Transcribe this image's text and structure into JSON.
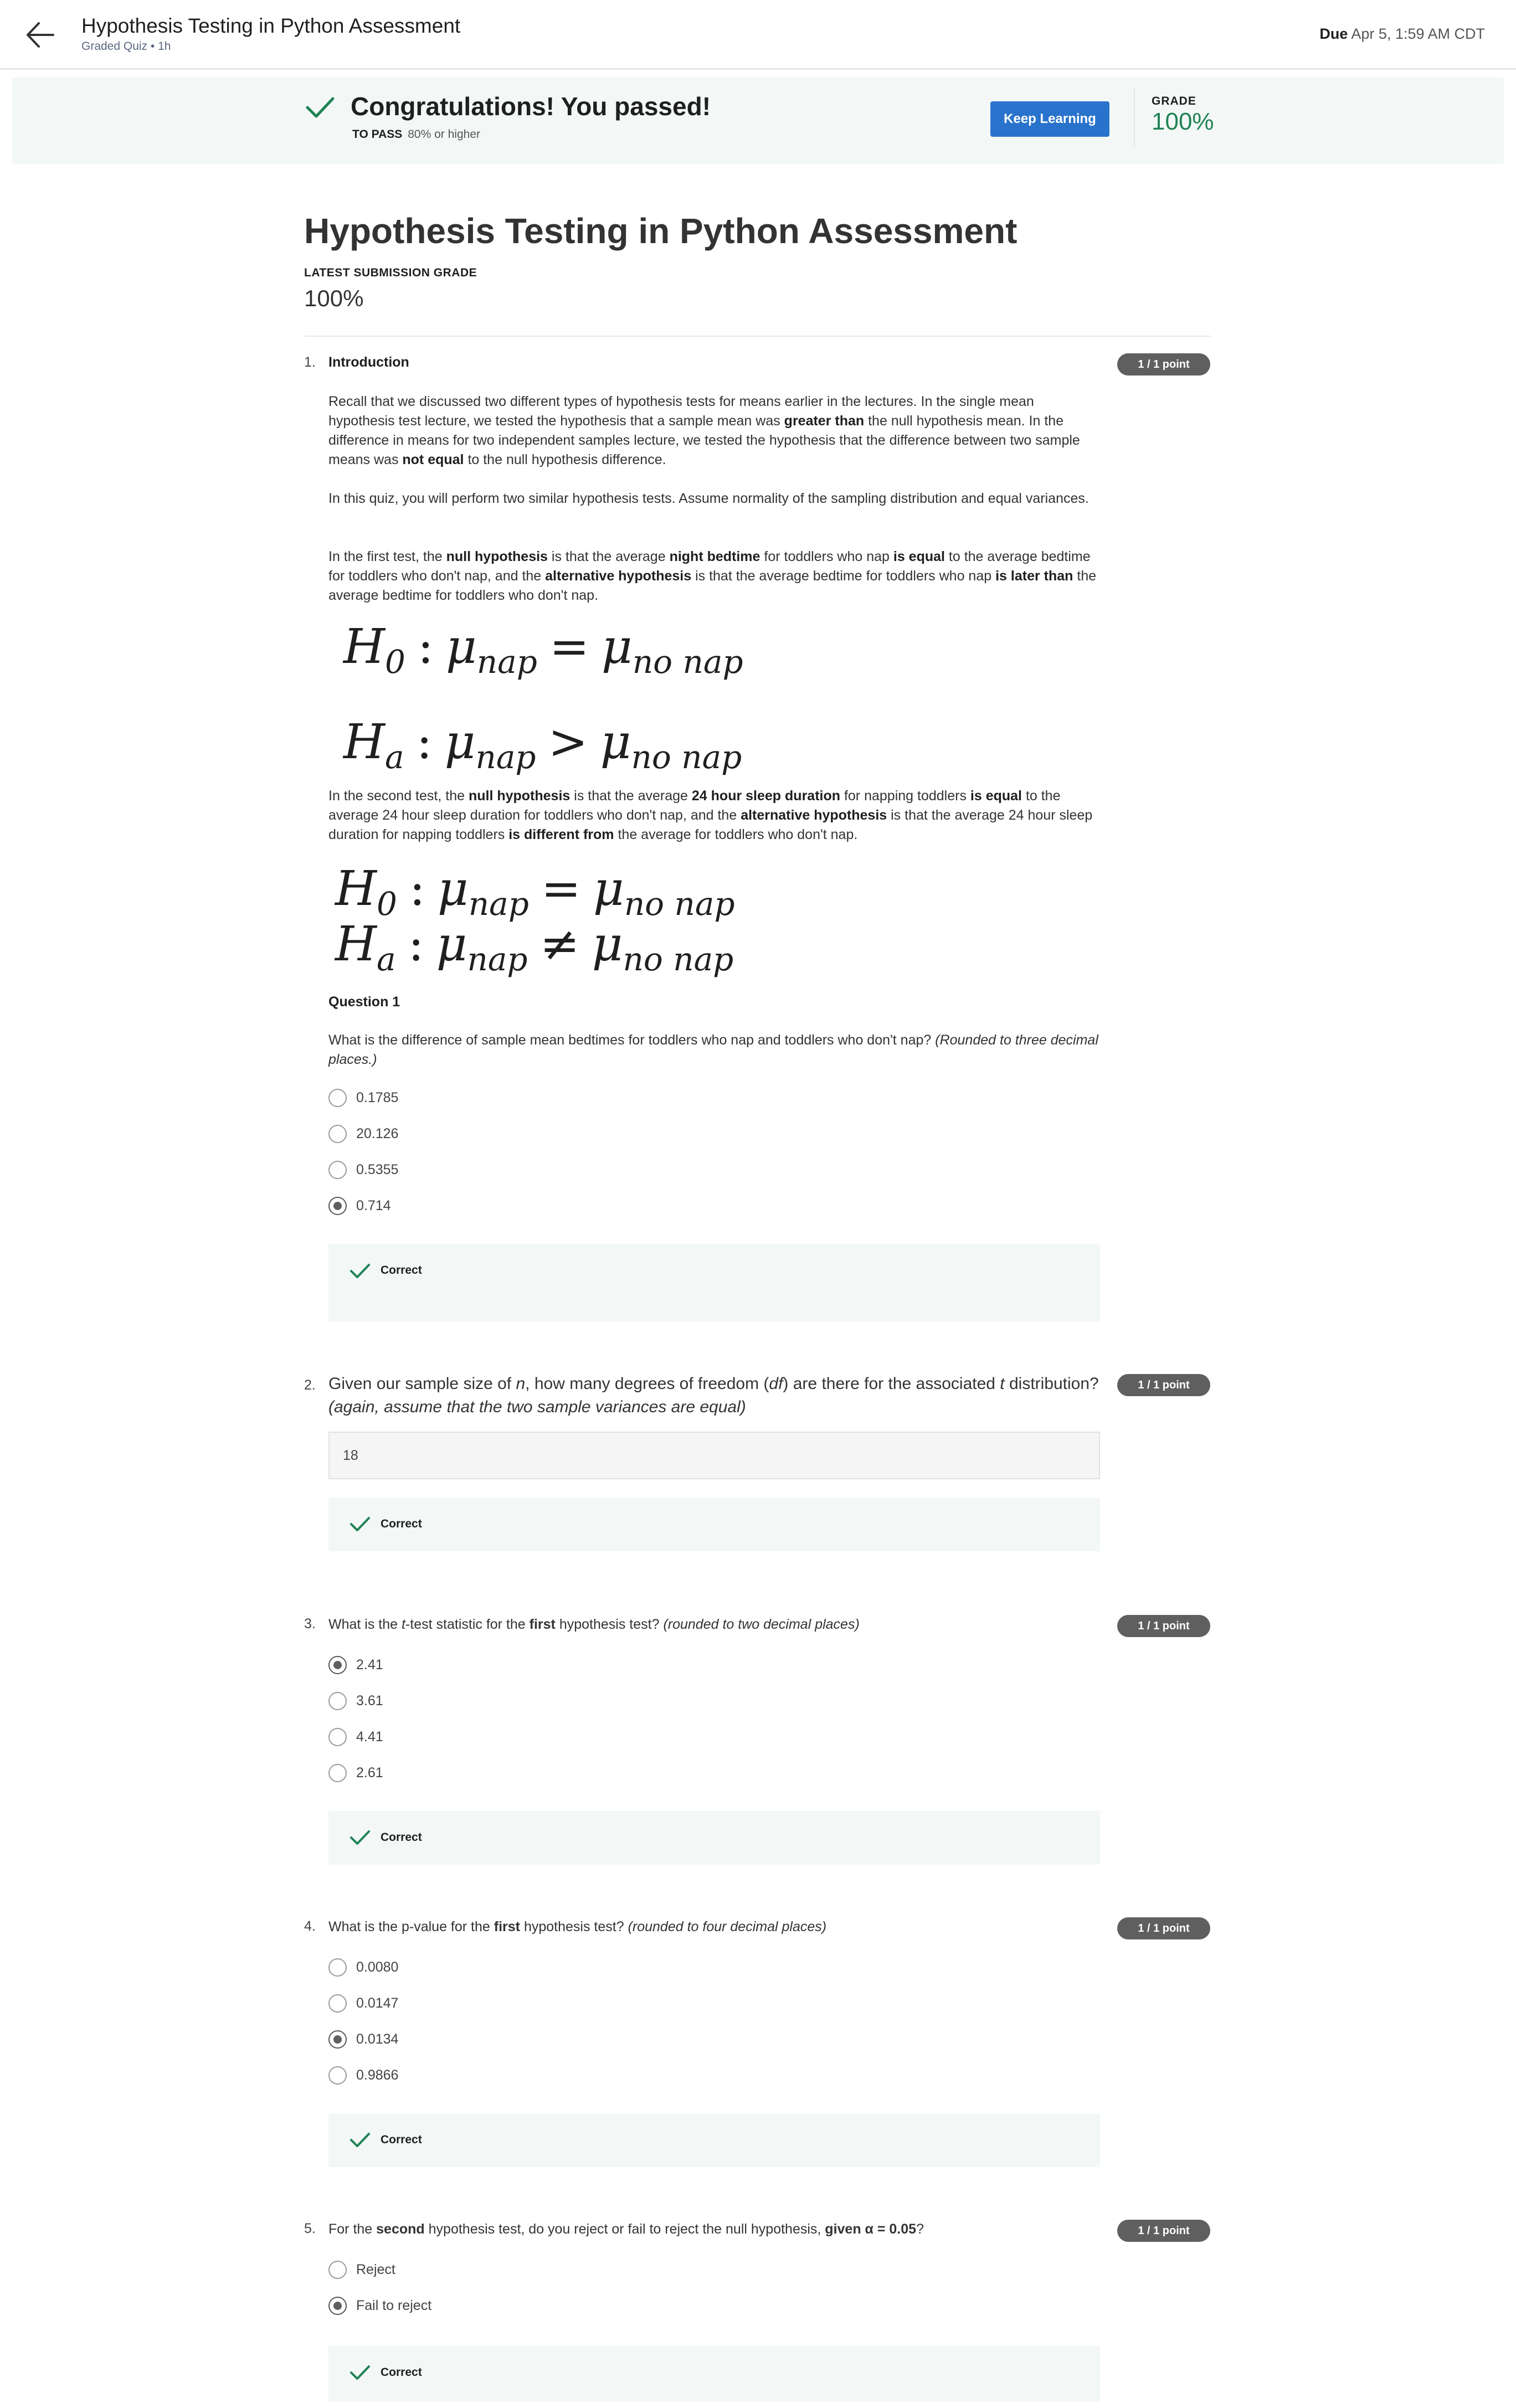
{
  "header": {
    "title": "Hypothesis Testing in Python Assessment",
    "subtitle": "Graded Quiz • 1h",
    "due_label": "Due",
    "due_value": "Apr 5, 1:59 AM CDT"
  },
  "banner": {
    "message": "Congratulations! You passed!",
    "to_pass_label": "TO PASS",
    "to_pass_value": "80% or higher",
    "keep_learning": "Keep Learning",
    "grade_label": "GRADE",
    "grade_value": "100%"
  },
  "page": {
    "title": "Hypothesis Testing in Python Assessment",
    "latest_label": "LATEST SUBMISSION GRADE",
    "latest_value": "100%"
  },
  "q1": {
    "number": "1.",
    "title": "Introduction",
    "points": "1 / 1 point",
    "para1": "Recall that we discussed two different types of hypothesis tests for means earlier in the lectures. In the single mean hypothesis test lecture, we tested the hypothesis that a sample mean was <b>greater than</b> the null hypothesis mean. In the difference in means for two independent samples lecture, we tested the hypothesis that the difference between two sample means was <b>not equal</b> to the null hypothesis difference.",
    "para2": "In this quiz, you will perform two similar hypothesis tests. Assume normality of the sampling distribution and equal variances.",
    "para3": "In the first test, the <b>null hypothesis</b> is that the average <b>night bedtime</b> for toddlers who nap <b>is equal</b> to the average bedtime for toddlers who don't nap, and the <b>alternative hypothesis</b> is that the average bedtime for toddlers who nap <b>is later than</b> the average bedtime for toddlers who don't nap.",
    "para4": "In the second test, the <b>null hypothesis</b> is that the average <b>24 hour sleep duration</b> for napping toddlers <b>is equal</b> to the average 24 hour sleep duration for toddlers who don't nap, and the <b>alternative hypothesis</b> is that the average 24 hour sleep duration for napping toddlers <b>is different from</b> the average for toddlers who don't nap.",
    "question_label": "Question 1",
    "question": "What is the difference of sample mean bedtimes for toddlers who nap and toddlers who don't nap? <i>(Rounded to three decimal places.)</i>",
    "options": [
      "0.1785",
      "20.126",
      "0.5355",
      "0.714"
    ],
    "feedback": "Correct"
  },
  "math": {
    "h0": "H",
    "h0_sub": "0",
    "ha": "H",
    "ha_sub": "a",
    "colon": ":",
    "mu": "μ",
    "nap": "nap",
    "no_nap": "no nap",
    "eq": "=",
    "gt": ">",
    "neq": "≠"
  },
  "q2": {
    "number": "2.",
    "points": "1 / 1 point",
    "question": "Given our sample size of <i>n</i>, how many degrees of freedom (<i>df</i>) are there for the associated <i>t</i> distribution? <i>(again, assume that the two sample variances are equal)</i>",
    "answer": "18",
    "feedback": "Correct"
  },
  "q3": {
    "number": "3.",
    "points": "1 / 1 point",
    "question": "What is the <i>t</i>-test statistic for the <b>first</b> hypothesis test? <i>(rounded to two decimal places)</i>",
    "options": [
      "2.41",
      "3.61",
      "4.41",
      "2.61"
    ],
    "feedback": "Correct"
  },
  "q4": {
    "number": "4.",
    "points": "1 / 1 point",
    "question": "What is the p-value for the <b>first</b> hypothesis test? <i>(rounded to four decimal places)</i>",
    "options": [
      "0.0080",
      "0.0147",
      "0.0134",
      "0.9866"
    ],
    "feedback": "Correct"
  },
  "q5": {
    "number": "5.",
    "points": "1 / 1 point",
    "question": "For the <b>second</b> hypothesis test, do you reject or fail to reject the null hypothesis, <b>given α = 0.05</b>?",
    "options": [
      "Reject",
      "Fail to reject"
    ],
    "feedback": "Correct"
  }
}
